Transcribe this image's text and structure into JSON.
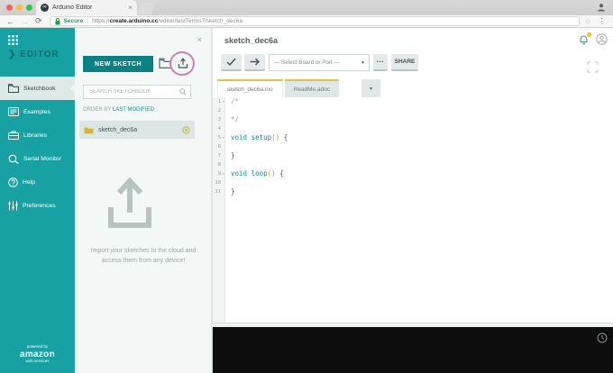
{
  "colors": {
    "sidebar_teal": "#18a1a2",
    "logo_teal": "#0b6e72",
    "new_sketch_button_teal": "#0c8184",
    "accent_teal": "#00979c",
    "highlight_ring_pink": "#cb7ec0",
    "tab_top_gold": "#e0c14a",
    "folder_yellow": "#ddb327",
    "secure_green": "#1a9e46",
    "console_black": "#0d0d0d"
  },
  "browser": {
    "tab_title": "Arduino Editor",
    "tab_close": "×",
    "back": "←",
    "forward": "→",
    "reload": "⟳",
    "secure_label": "Secure",
    "separator": "|",
    "url_scheme": "https://",
    "url_domain": "create.arduino.cc",
    "url_path": "/editor/testTerms7/sketch_dec6a",
    "star": "☆",
    "menu": "⋮"
  },
  "sidebar": {
    "logo_text": "❯ EDITOR",
    "items": [
      {
        "label": "Sketchbook",
        "icon": "sketchbook-folder-icon",
        "active": true
      },
      {
        "label": "Examples",
        "icon": "examples-icon",
        "active": false
      },
      {
        "label": "Libraries",
        "icon": "libraries-icon",
        "active": false
      },
      {
        "label": "Serial Monitor",
        "icon": "serial-monitor-icon",
        "active": false
      },
      {
        "label": "Help",
        "icon": "help-icon",
        "active": false
      },
      {
        "label": "Preferences",
        "icon": "preferences-icon",
        "active": false
      }
    ],
    "aws": {
      "powered_by": "powered by",
      "brand": "amazon",
      "sub": "web services"
    }
  },
  "panel": {
    "close_label": "×",
    "new_sketch_label": "NEW SKETCH",
    "search_placeholder": "SEARCH SKETCHBOOK",
    "order_by_label": "ORDER BY ",
    "order_by_value": "LAST MODIFIED",
    "sketches": [
      {
        "name": "sketch_dec6a"
      }
    ],
    "import_hint": "Import your sketches to the cloud and access them from any device!"
  },
  "main": {
    "title": "sketch_dec6a",
    "board_select": "— Select Board or Port —",
    "more_label": "•••",
    "share_label": "SHARE",
    "tab_caret": "▾",
    "board_caret": "▾",
    "tabs": [
      {
        "label": "sketch_dec6a.ino",
        "active": true
      },
      {
        "label": "ReadMe.adoc",
        "active": false
      }
    ],
    "code": {
      "lines": [
        {
          "n": "1",
          "fold": true,
          "tokens": [
            {
              "s": "/*",
              "c": "comment"
            }
          ]
        },
        {
          "n": "2",
          "fold": false,
          "tokens": []
        },
        {
          "n": "3",
          "fold": false,
          "tokens": [
            {
              "s": "*/",
              "c": "comment"
            }
          ]
        },
        {
          "n": "4",
          "fold": false,
          "tokens": []
        },
        {
          "n": "5",
          "fold": true,
          "tokens": [
            {
              "s": "void ",
              "c": "keyword"
            },
            {
              "s": "setup",
              "c": "function"
            },
            {
              "s": "()",
              "c": "paren"
            },
            {
              "s": " {",
              "c": "brace"
            }
          ]
        },
        {
          "n": "6",
          "fold": false,
          "tokens": []
        },
        {
          "n": "7",
          "fold": false,
          "tokens": [
            {
              "s": "}",
              "c": "brace"
            }
          ]
        },
        {
          "n": "8",
          "fold": false,
          "tokens": []
        },
        {
          "n": "9",
          "fold": true,
          "tokens": [
            {
              "s": "void ",
              "c": "keyword"
            },
            {
              "s": "loop",
              "c": "function"
            },
            {
              "s": "()",
              "c": "paren"
            },
            {
              "s": " {",
              "c": "brace"
            }
          ]
        },
        {
          "n": "10",
          "fold": false,
          "tokens": []
        },
        {
          "n": "11",
          "fold": false,
          "tokens": [
            {
              "s": "}",
              "c": "brace"
            }
          ]
        }
      ]
    }
  }
}
